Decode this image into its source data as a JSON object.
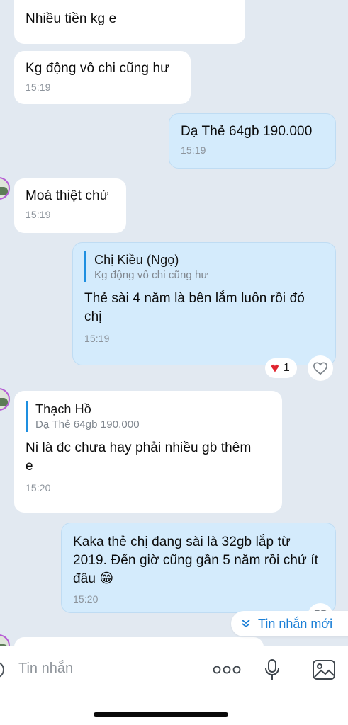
{
  "messages": [
    {
      "id": "m1",
      "text": "Nhiều tiền kg e"
    },
    {
      "id": "m2",
      "text": "Kg động vô chi cũng hư",
      "time": "15:19"
    },
    {
      "id": "m3",
      "text": "Dạ Thẻ 64gb 190.000",
      "time": "15:19"
    },
    {
      "id": "m4",
      "text": "Moá thiệt chứ",
      "time": "15:19"
    },
    {
      "id": "m5",
      "quote_name": "Chị Kiều (Ngọ)",
      "quote_text": "Kg động vô chi cũng hư",
      "text": "Thẻ sài 4 năm là bên lắm luôn rồi đó chị",
      "time": "15:19",
      "reaction_count": "1"
    },
    {
      "id": "m6",
      "quote_name": "Thạch Hồ",
      "quote_text": "Dạ Thẻ 64gb 190.000",
      "text": "Ni là đc chưa hay phải nhiều gb thêm e",
      "time": "15:20"
    },
    {
      "id": "m7",
      "text": "Kaka thẻ chị đang sài là 32gb lắp từ 2019. Đến giờ cũng gần 5 năm rồi chứ ít đâu 😁",
      "time": "15:20"
    }
  ],
  "new_messages_label": "Tin nhắn mới",
  "composer": {
    "placeholder": "Tin nhắn"
  },
  "icons": {
    "sticker": "sticker-icon",
    "more": "more-icon",
    "mic": "microphone-icon",
    "image": "image-icon",
    "heart": "heart-icon",
    "chevron": "chevron-down-double-icon"
  },
  "colors": {
    "accent": "#1e8fe0",
    "out_bubble": "#d4ebfc",
    "background": "#e2e9f1"
  }
}
